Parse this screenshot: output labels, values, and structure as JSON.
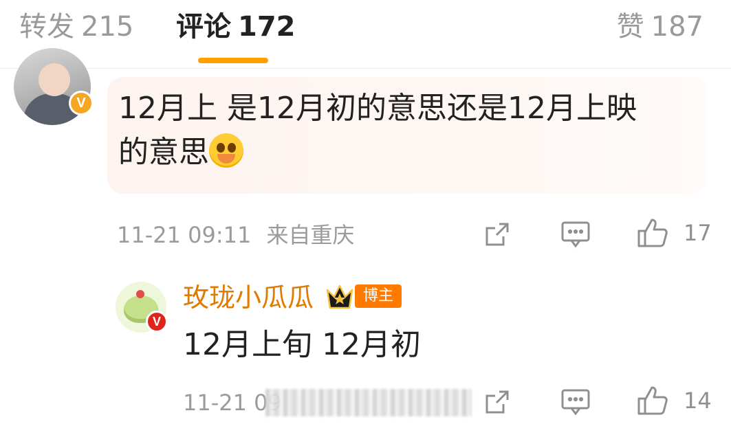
{
  "tabs": {
    "repost": {
      "label": "转发",
      "count": "215"
    },
    "comment": {
      "label": "评论",
      "count": "172"
    },
    "like": {
      "label": "赞",
      "count": "187"
    }
  },
  "comment": {
    "text_line1": "12月上 是12月初的意思还是12月上映",
    "text_line2": "的意思",
    "emoji_icon": "crying-face-emoji",
    "timestamp": "11-21 09:11",
    "location": "来自重庆",
    "like_count": "17",
    "verified_badge": "V"
  },
  "reply": {
    "username": "玫珑小瓜瓜",
    "badge": "博主",
    "text": "12月上旬 12月初",
    "timestamp": "11-21 09",
    "like_count": "14",
    "verified_badge": "V"
  },
  "colors": {
    "accent": "#ff9f00",
    "username": "#e07a00",
    "bubble_bg": "#fdf3ef",
    "muted": "#9b9b9b"
  }
}
